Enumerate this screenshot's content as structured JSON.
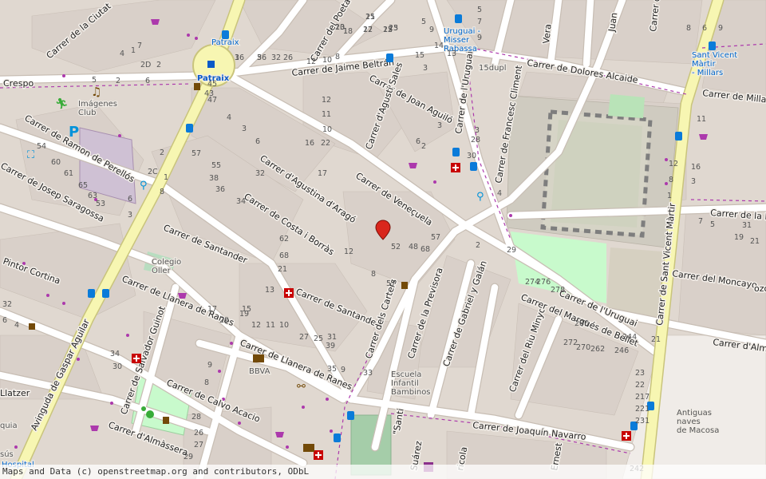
{
  "streets": {
    "crespo": "Crespo",
    "ciutat": "Carrer de la Ciutat",
    "poeta": "Carrer del Poeta",
    "jaime_beltran": "Carrer de Jaime Beltrán",
    "joan_aguilo": "Carrer de Joan Aguiló",
    "agusti_sales": "Carrer d'Agustí Sales",
    "uruguai_n": "Carrer de l'Uruguai",
    "francesc_climent": "Carrer de Francesc Climent",
    "dolores_alcaide": "Carrer de Dolores Alcaide",
    "millars": "Carrer de Millars",
    "ramon_perellos": "Carrer de Ramon de Perellós",
    "josep_saragossa": "Carrer de Josep Saragossa",
    "agustina": "Carrer d'Agustina d'Aragó",
    "venecuela": "Carrer de Veneçuela",
    "costa_borras": "Carrer de Costa i Borràs",
    "santander_1": "Carrer de Santander",
    "santander_2": "Carrer de Santander",
    "pintor_cortina": "Pintor Cortina",
    "llanera_1": "Carrer de Llanera de Ranes",
    "llanera_2": "Carrer de Llanera de Ranes",
    "gaspar_aguilar": "Avinguda de Gaspar Aguilar",
    "salvador_guinot": "Carrer de Salvador Guinot",
    "calvo_acacio": "Carrer de Calvo Acacio",
    "almassera": "Carrer d'Almàssera",
    "latzer": "Llatzer",
    "carters": "Carrer dels Carters",
    "previsora": "Carrer de la Previsora",
    "gabriel_galan": "Carrer de Gabriel y Galán",
    "riu_minyo": "Carrer del Riu Minyo",
    "marques_bellet": "Carrer del Marqués de Bellet",
    "uruguai_s": "Carrer de l'Uruguai",
    "sant_vicent": "Carrer de Sant Vicent Màrtir",
    "moncayo": "Carrer del Moncayo",
    "alma": "Carrer d'Alma",
    "de_la_p": "Carrer de la P",
    "joaquin_navarro": "Carrer de Joaquín Navarro",
    "suarez": "Suárez",
    "santi": "\"Santi",
    "ricola": "ricola",
    "ernest": "Ernest",
    "juan": "Juan",
    "meta": "Carrer del Met",
    "vera": "Vera",
    "ozo": "ozo"
  },
  "pois": {
    "patraix_bus": "Patraix",
    "patraix_metro": "Patraix",
    "imagenes_club": "Imágenes\nClub",
    "uruguai_misser": "Uruguai -\nMisser\nRabassa",
    "sant_vicent_stop": "Sant Vicent\nMàrtir\n- Millars",
    "colegio_oller": "Colegio\nOller",
    "bbva": "BBVA",
    "escuela": "Escuela\nInfantil\nBambinos",
    "antiguas_naves": "Antiguas\nnaves\nde Macosa",
    "hospital": "Hospital",
    "quia": "quia",
    "sus": "sús",
    "num_15dupl": "15dupl"
  },
  "house_numbers": [
    "21",
    "23",
    "22",
    "12",
    "10",
    "18",
    "16",
    "36",
    "32",
    "26",
    "2D",
    "2",
    "7",
    "1",
    "4",
    "6",
    "5",
    "2",
    "12",
    "10",
    "8",
    "15",
    "14",
    "13",
    "9",
    "5",
    "3",
    "47",
    "45",
    "43",
    "4",
    "3",
    "6",
    "11",
    "12",
    "10",
    "16",
    "22",
    "17",
    "3",
    "2",
    "6",
    "4",
    "2",
    "29",
    "52",
    "48",
    "68",
    "57",
    "12",
    "8",
    "57",
    "62",
    "68",
    "21",
    "13",
    "15",
    "17",
    "19",
    "20",
    "12",
    "11",
    "10",
    "9",
    "8",
    "28",
    "26",
    "27",
    "29",
    "31",
    "33",
    "35",
    "9",
    "39",
    "27",
    "25",
    "34",
    "30",
    "32",
    "6",
    "4",
    "2C",
    "3",
    "2",
    "1",
    "8",
    "6",
    "54",
    "60",
    "61",
    "65",
    "63",
    "53",
    "57",
    "55",
    "38",
    "36",
    "34",
    "32",
    "30",
    "28",
    "3",
    "5",
    "7",
    "9",
    "11",
    "16",
    "3",
    "12",
    "8",
    "1",
    "21",
    "23",
    "22",
    "217",
    "221",
    "231",
    "242",
    "244",
    "246",
    "262",
    "270",
    "272",
    "274",
    "276",
    "278",
    "280",
    "8",
    "6",
    "9",
    "7",
    "5",
    "31",
    "19",
    "21",
    "15",
    "15",
    "17",
    "25",
    "23",
    "1",
    "3",
    "5"
  ],
  "attribution": "Maps and Data (c) openstreetmap.org and contributors, ODbL",
  "colors": {
    "background": "#e0d8d0",
    "building": "#d9d0c9",
    "road_white": "#ffffff",
    "road_yellow": "#f7f6b2",
    "road_casing": "#c8beb4",
    "park": "#c8facc",
    "pitch": "#aae0cb",
    "marker": "#d9261c",
    "bus_blue": "#0a7bd9",
    "pharmacy": "#c80000",
    "purple": "#ac39ac"
  }
}
